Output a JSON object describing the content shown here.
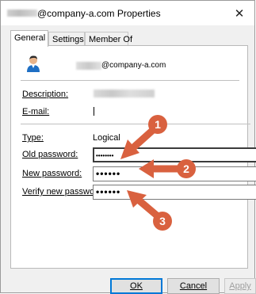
{
  "window": {
    "title": "@company-a.com Properties",
    "close_glyph": "✕"
  },
  "tabs": [
    {
      "label": "General",
      "active": true
    },
    {
      "label": "Settings",
      "active": false
    },
    {
      "label": "Member Of",
      "active": false
    }
  ],
  "general": {
    "account_name": "@company-a.com",
    "description_label": "Description:",
    "email_label": "E-mail:",
    "type_label": "Type:",
    "type_value": "Logical",
    "old_password_label": "Old password:",
    "old_password_value": "••••••••",
    "new_password_label": "New password:",
    "new_password_value": "••••••",
    "verify_password_label": "Verify new password:",
    "verify_password_value": "••••••"
  },
  "buttons": {
    "ok": "OK",
    "cancel": "Cancel",
    "apply": "Apply"
  },
  "annotations": {
    "step1": "1",
    "step2": "2",
    "step3": "3",
    "color": "#d9613f"
  }
}
